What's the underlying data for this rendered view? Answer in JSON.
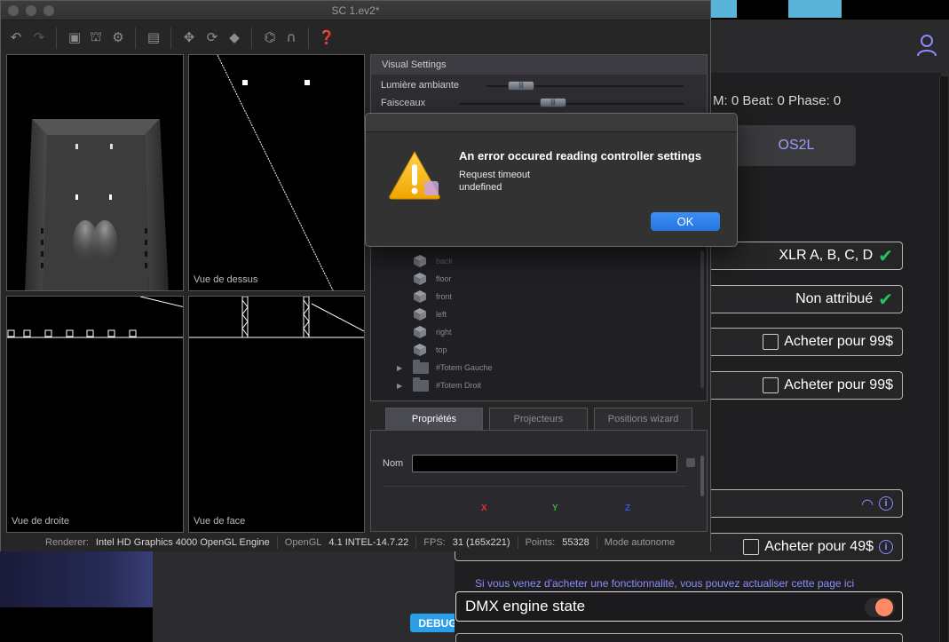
{
  "window": {
    "title": "SC 1.ev2*"
  },
  "toolbar": {
    "icons": [
      "undo-icon",
      "redo-icon",
      "fit-view-icon",
      "stage-icon",
      "settings-icon",
      "chart-icon",
      "move-icon",
      "rotate-icon",
      "scale-icon",
      "truss-icon",
      "magnet-icon",
      "help-icon"
    ]
  },
  "views": {
    "top_left": "",
    "top_right": "Vue de dessus",
    "bottom_left": "Vue de droite",
    "bottom_right": "Vue de face"
  },
  "visual_settings": {
    "title": "Visual  Settings",
    "rows": [
      {
        "label": "Lumière ambiante",
        "value": 0.2
      },
      {
        "label": "Faisceaux",
        "value": 0.35
      }
    ]
  },
  "tree": {
    "items": [
      {
        "label": "back",
        "type": "cube"
      },
      {
        "label": "floor",
        "type": "cube"
      },
      {
        "label": "front",
        "type": "cube"
      },
      {
        "label": "left",
        "type": "cube"
      },
      {
        "label": "right",
        "type": "cube"
      },
      {
        "label": "top",
        "type": "cube"
      },
      {
        "label": "#Totem Gauche",
        "type": "folder"
      },
      {
        "label": "#Totem Droit",
        "type": "folder"
      }
    ]
  },
  "tabs": [
    {
      "label": "Propriétés",
      "active": true
    },
    {
      "label": "Projecteurs",
      "active": false
    },
    {
      "label": "Positions wizard",
      "active": false
    }
  ],
  "properties": {
    "nom_label": "Nom",
    "nom_value": "",
    "axes": [
      {
        "label": "X",
        "color": "#e03030"
      },
      {
        "label": "Y",
        "color": "#2fb82f"
      },
      {
        "label": "Z",
        "color": "#3355ee"
      }
    ]
  },
  "statusbar": {
    "renderer_label": "Renderer:",
    "renderer_value": "Intel HD Graphics 4000 OpenGL Engine",
    "opengl_label": "OpenGL",
    "opengl_value": "4.1 INTEL-14.7.22",
    "fps_label": "FPS:",
    "fps_value": "31 (165x221)",
    "points_label": "Points:",
    "points_value": "55328",
    "mode": "Mode autonome"
  },
  "dialog": {
    "title": "An error occured reading controller settings",
    "line1": "Request timeout",
    "line2": "undefined",
    "ok": "OK"
  },
  "background_app": {
    "bpm_text": "M: 0 Beat: 0 Phase: 0",
    "os2l": "OS2L",
    "rows": [
      {
        "label": "XLR A, B, C, D"
      },
      {
        "label": "Non attribué"
      },
      {
        "label": "Acheter pour 99$"
      },
      {
        "label": "Acheter pour 99$"
      },
      {
        "label": "Acheter pour 49$"
      }
    ],
    "hint": "Si vous venez d'acheter une fonctionnalité, vous pouvez actualiser cette page ici",
    "dmx_label": "DMX engine state",
    "debug": "DEBUG",
    "accent": "#8b8bff",
    "check_color": "#22c55e"
  }
}
